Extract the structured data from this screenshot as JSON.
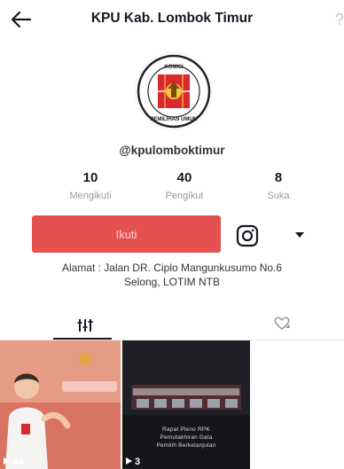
{
  "header": {
    "title": "KPU Kab. Lombok Timur",
    "back_icon": "arrow-left-icon",
    "edge_glyph": "?"
  },
  "profile": {
    "username": "@kpulomboktimur",
    "avatar_icon": "kpu-emblem",
    "stats": [
      {
        "value": "10",
        "label": "Mengikuti"
      },
      {
        "value": "40",
        "label": "Pengikut"
      },
      {
        "value": "8",
        "label": "Suka"
      }
    ],
    "follow_label": "Ikuti",
    "instagram_icon": "instagram-icon",
    "more_icon": "caret-down-icon",
    "bio_line1": "Alamat : Jalan DR. Ciplo Mangunkusumo No.6",
    "bio_line2": "Selong, LOTIM NTB"
  },
  "tabs": {
    "videos_icon": "grid-bars-icon",
    "liked_icon": "liked-heart-icon"
  },
  "videos": [
    {
      "views": "44"
    },
    {
      "views": "3",
      "caption": [
        "Rapat Pleno RPK",
        "Pemutakhiran Data",
        "Pemilih Berkelanjutan"
      ]
    }
  ],
  "colors": {
    "accent": "#e4514e",
    "text_primary": "#161823",
    "text_secondary": "#9a9a9a"
  }
}
